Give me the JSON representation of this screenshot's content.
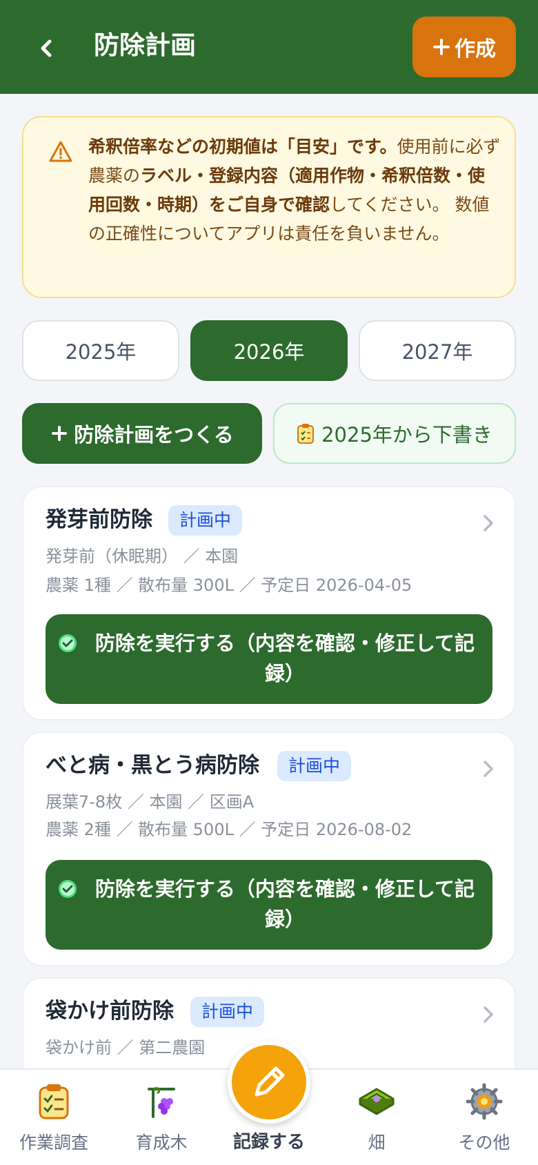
{
  "header": {
    "back_icon": "chevron-left-icon",
    "title": "防除計画",
    "create_label": "作成"
  },
  "notice": {
    "icon": "warning-icon",
    "bold1": "希釈倍率などの初期値は「目安」です。",
    "text1": "使用前に必ず農薬の",
    "bold2": "ラベル・登録内容（適用作物・希釈倍数・使用回数・時期）をご自身で確認",
    "text2": "してください。 数値の正確性についてアプリは責任を負いません。"
  },
  "years": [
    {
      "label": "2025年",
      "selected": false
    },
    {
      "label": "2026年",
      "selected": true
    },
    {
      "label": "2027年",
      "selected": false
    }
  ],
  "actions": {
    "make_plan_label": "防除計画をつくる",
    "draft_label": "2025年から下書き"
  },
  "plans": [
    {
      "title": "発芽前防除",
      "status": "計画中",
      "meta1": "発芽前（休眠期） ／ 本園",
      "meta2": "農薬 1種 ／ 散布量 300L ／ 予定日 2026-04-05",
      "exec_label": "防除を実行する（内容を確認・修正して記録）"
    },
    {
      "title": "べと病・黒とう病防除",
      "status": "計画中",
      "meta1": "展葉7-8枚 ／ 本園 ／ 区画A",
      "meta2": "農薬 2種 ／ 散布量 500L ／ 予定日 2026-08-02",
      "exec_label": "防除を実行する（内容を確認・修正して記録）"
    },
    {
      "title": "袋かけ前防除",
      "status": "計画中",
      "meta1": "袋かけ前 ／ 第二農園"
    }
  ],
  "nav": {
    "items": [
      {
        "label": "作業調査",
        "icon": "clipboard-check-icon"
      },
      {
        "label": "育成木",
        "icon": "grape-vine-icon"
      },
      {
        "label": "記録する",
        "icon": "pencil-icon"
      },
      {
        "label": "畑",
        "icon": "field-plot-icon"
      },
      {
        "label": "その他",
        "icon": "gear-icon"
      }
    ]
  },
  "colors": {
    "primary": "#2d6a2d",
    "accent": "#d9730d",
    "fab": "#f5a30a",
    "badge_bg": "#dbeafe",
    "badge_text": "#1d4ed8",
    "notice_bg": "#fef9e0"
  }
}
